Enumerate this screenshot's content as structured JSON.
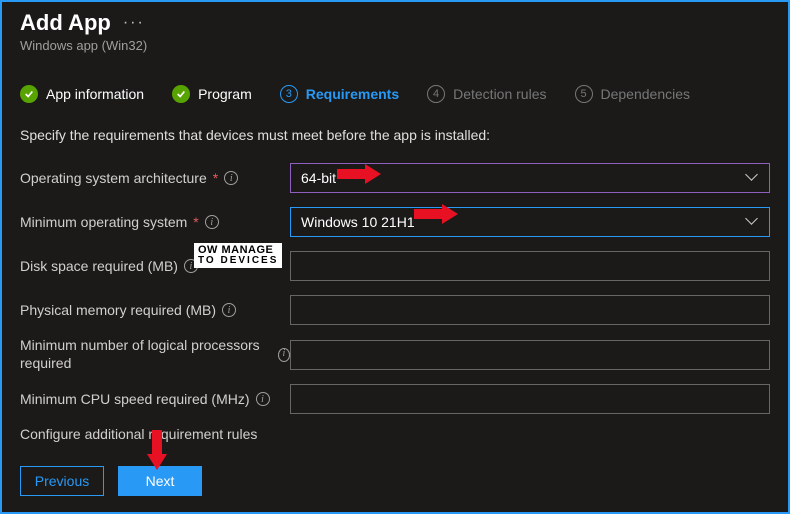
{
  "header": {
    "title": "Add App",
    "subtitle": "Windows app (Win32)"
  },
  "tabs": {
    "app_info": "App information",
    "program": "Program",
    "requirements": "Requirements",
    "detection": "Detection rules",
    "dependencies": "Dependencies",
    "num3": "3",
    "num4": "4",
    "num5": "5"
  },
  "description": "Specify the requirements that devices must meet before the app is installed:",
  "fields": {
    "os_arch": {
      "label": "Operating system architecture",
      "value": "64-bit"
    },
    "min_os": {
      "label": "Minimum operating system",
      "value": "Windows 10 21H1"
    },
    "disk": {
      "label": "Disk space required (MB)",
      "value": ""
    },
    "mem": {
      "label": "Physical memory required (MB)",
      "value": ""
    },
    "cpu_n": {
      "label": "Minimum number of logical processors required",
      "value": ""
    },
    "cpu_s": {
      "label": "Minimum CPU speed required (MHz)",
      "value": ""
    }
  },
  "section_rules": "Configure additional requirement rules",
  "buttons": {
    "prev": "Previous",
    "next": "Next"
  },
  "watermark": {
    "l1": "OW MANAGE",
    "l2": "TO DEVICES"
  },
  "info_glyph": "i",
  "req_glyph": "*",
  "ellipsis": "···"
}
